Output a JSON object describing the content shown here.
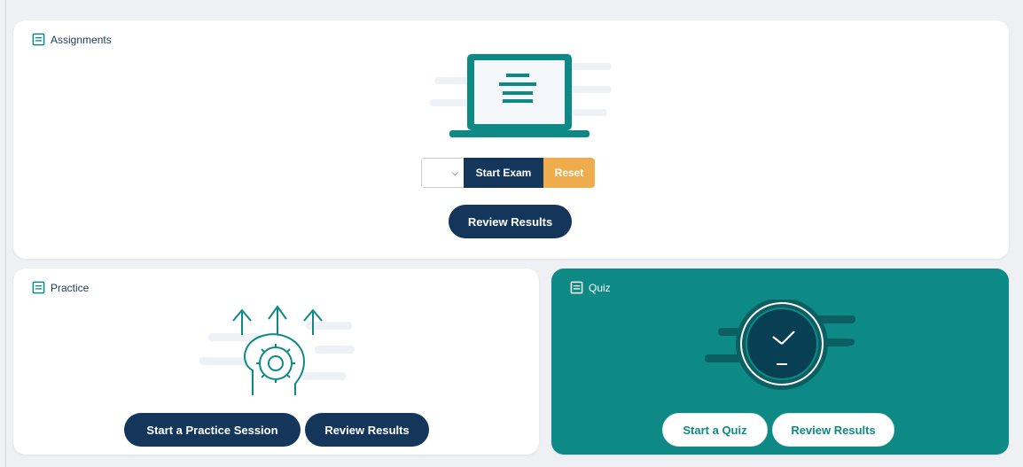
{
  "colors": {
    "navy": "#14365b",
    "teal": "#0d8a86",
    "orange": "#eeac4c",
    "background": "#eef0f4",
    "card": "#ffffff"
  },
  "assignments": {
    "title": "Assignments",
    "title_icon": "book-icon",
    "illustration": "laptop-document-illustration",
    "exam_select_value": "",
    "start_exam_label": "Start Exam",
    "reset_label": "Reset",
    "review_label": "Review Results"
  },
  "practice": {
    "title": "Practice",
    "title_icon": "book-icon",
    "illustration": "brain-gear-arrows-illustration",
    "start_label": "Start a Practice Session",
    "review_label": "Review Results"
  },
  "quiz": {
    "title": "Quiz",
    "title_icon": "book-icon",
    "illustration": "stopwatch-clock-illustration",
    "start_label": "Start a Quiz",
    "review_label": "Review Results"
  }
}
